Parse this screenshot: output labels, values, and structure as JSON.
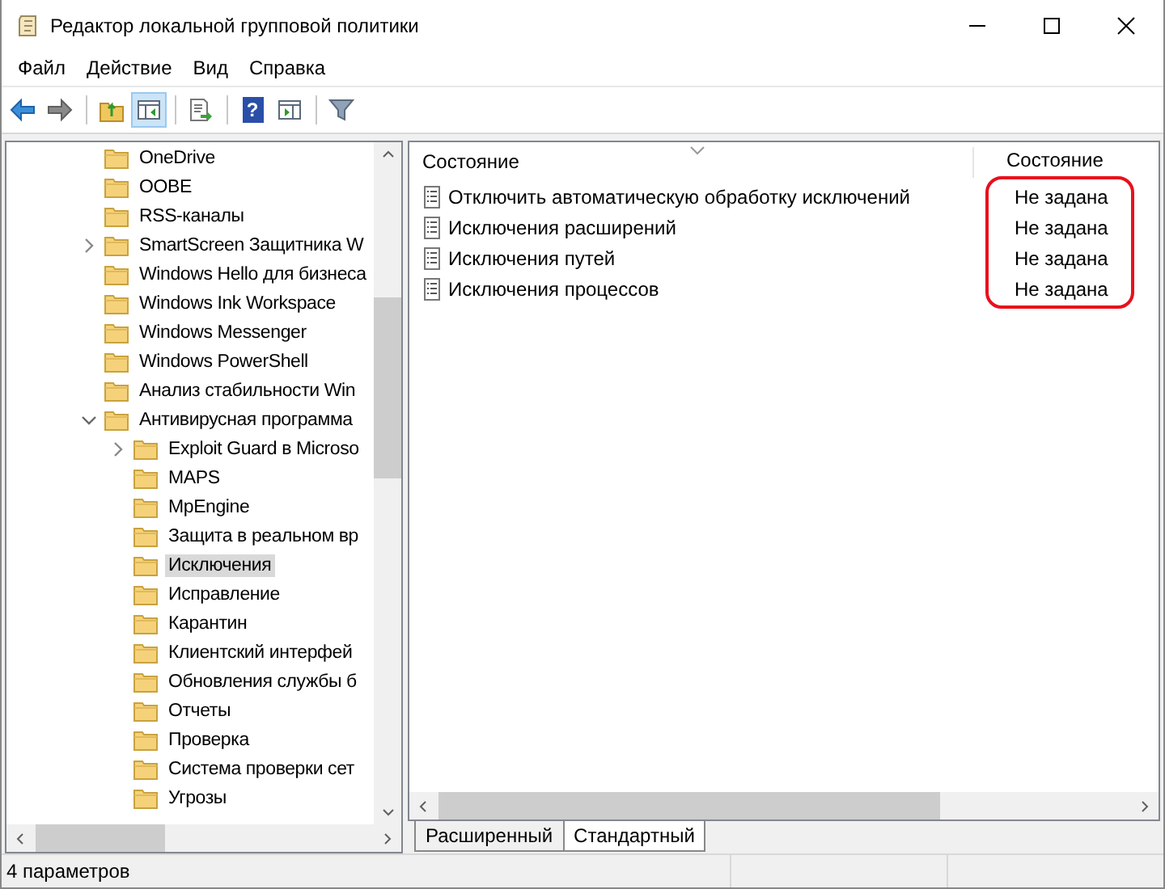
{
  "window": {
    "title": "Редактор локальной групповой политики"
  },
  "menu": [
    "Файл",
    "Действие",
    "Вид",
    "Справка"
  ],
  "toolbar": [
    {
      "kind": "back",
      "pressed": false
    },
    {
      "kind": "forward",
      "pressed": false
    },
    {
      "kind": "separator"
    },
    {
      "kind": "up",
      "pressed": false
    },
    {
      "kind": "tree",
      "pressed": true
    },
    {
      "kind": "separator"
    },
    {
      "kind": "export",
      "pressed": false
    },
    {
      "kind": "separator"
    },
    {
      "kind": "help",
      "pressed": false,
      "label": "?"
    },
    {
      "kind": "pane",
      "pressed": false
    },
    {
      "kind": "separator"
    },
    {
      "kind": "filter",
      "pressed": false
    }
  ],
  "tree": {
    "items": [
      {
        "label": "OneDrive",
        "kind": "leaf",
        "selected": false
      },
      {
        "label": "OOBE",
        "kind": "leaf",
        "selected": false
      },
      {
        "label": "RSS-каналы",
        "kind": "leaf",
        "selected": false
      },
      {
        "label": "SmartScreen Защитника W",
        "kind": "branch",
        "expanded": false,
        "selected": false
      },
      {
        "label": "Windows Hello для бизнеса",
        "kind": "leaf",
        "selected": false
      },
      {
        "label": "Windows Ink Workspace",
        "kind": "leaf",
        "selected": false
      },
      {
        "label": "Windows Messenger",
        "kind": "leaf",
        "selected": false
      },
      {
        "label": "Windows PowerShell",
        "kind": "leaf",
        "selected": false
      },
      {
        "label": "Анализ стабильности Win",
        "kind": "leaf",
        "selected": false
      },
      {
        "label": "Антивирусная программа",
        "kind": "branch",
        "expanded": true,
        "selected": false,
        "children": [
          {
            "label": "Exploit Guard в Microso",
            "kind": "branch",
            "expanded": false,
            "selected": false
          },
          {
            "label": "MAPS",
            "kind": "leaf",
            "selected": false
          },
          {
            "label": "MpEngine",
            "kind": "leaf",
            "selected": false
          },
          {
            "label": "Защита в реальном вр",
            "kind": "leaf",
            "selected": false
          },
          {
            "label": "Исключения",
            "kind": "leaf",
            "selected": true
          },
          {
            "label": "Исправление",
            "kind": "leaf",
            "selected": false
          },
          {
            "label": "Карантин",
            "kind": "leaf",
            "selected": false
          },
          {
            "label": "Клиентский интерфей",
            "kind": "leaf",
            "selected": false
          },
          {
            "label": "Обновления службы б",
            "kind": "leaf",
            "selected": false
          },
          {
            "label": "Отчеты",
            "kind": "leaf",
            "selected": false
          },
          {
            "label": "Проверка",
            "kind": "leaf",
            "selected": false
          },
          {
            "label": "Система проверки сет",
            "kind": "leaf",
            "selected": false
          },
          {
            "label": "Угрозы",
            "kind": "leaf",
            "selected": false
          }
        ]
      }
    ]
  },
  "list": {
    "columns": [
      "Состояние",
      "Состояние"
    ],
    "status_highlighted": true,
    "rows": [
      {
        "name": "Отключить автоматическую обработку исключений",
        "state": "Не задана"
      },
      {
        "name": "Исключения расширений",
        "state": "Не задана"
      },
      {
        "name": "Исключения путей",
        "state": "Не задана"
      },
      {
        "name": "Исключения процессов",
        "state": "Не задана"
      }
    ]
  },
  "tabs": [
    {
      "label": "Расширенный",
      "selected": false
    },
    {
      "label": "Стандартный",
      "selected": true
    }
  ],
  "status_bar": "4 параметров"
}
